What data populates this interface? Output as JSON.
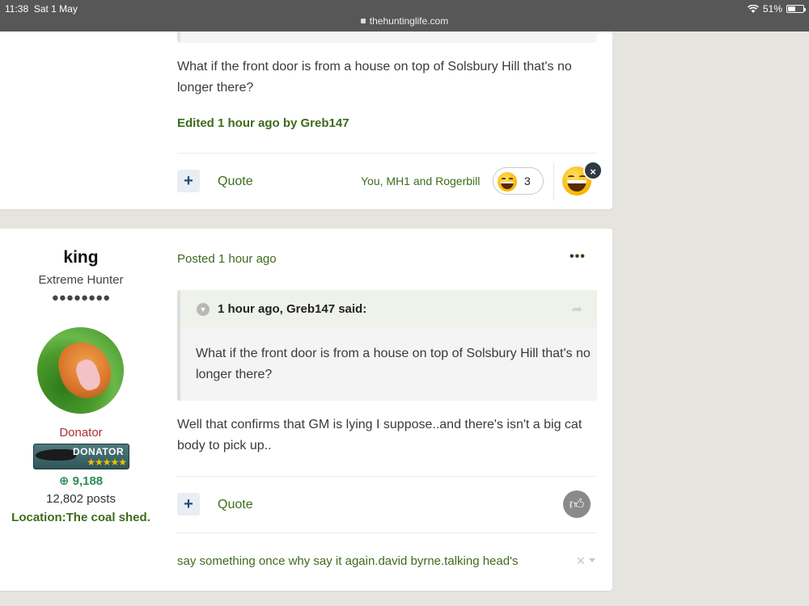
{
  "status_bar": {
    "time": "11:38",
    "date": "Sat 1 May",
    "url": "thehuntinglife.com",
    "battery": "51%",
    "battery_level": 0.51
  },
  "post1": {
    "body": "What if the front door is from a house on top of Solsbury Hill that's no longer there?",
    "edited": "Edited 1 hour ago by Greb147",
    "quote_label": "Quote",
    "reacted_by": "You, MH1 and Rogerbill",
    "reaction_count": "3",
    "plus_symbol": "+",
    "close_symbol": "×"
  },
  "post2": {
    "author": {
      "name": "king",
      "rank": "Extreme Hunter",
      "pips": "●●●●●●●●",
      "group": "Donator",
      "badge_text": "DONATOR",
      "badge_stars": "★★★★★",
      "reputation_icon": "plus-circle-icon",
      "reputation": "⊕ 9,188",
      "posts": "12,802 posts",
      "location": "Location:The coal shed."
    },
    "posted": "Posted 1 hour ago",
    "menu_dots": "•••",
    "quote": {
      "citation": "1 hour ago, Greb147 said:",
      "text": "What if the front door is from a house on top of Solsbury Hill that's no longer there?"
    },
    "body": "Well that confirms that GM is lying I suppose..and there's isn't a big cat body to pick up..",
    "quote_label": "Quote",
    "plus_symbol": "+",
    "signature": "say something once why say it again.david byrne.talking head's",
    "signature_close": "✕"
  },
  "colors": {
    "link_green": "#3e6b1c",
    "donator_red": "#a83232",
    "reputation_green": "#2e8b57",
    "page_bg": "#e6e4df"
  }
}
